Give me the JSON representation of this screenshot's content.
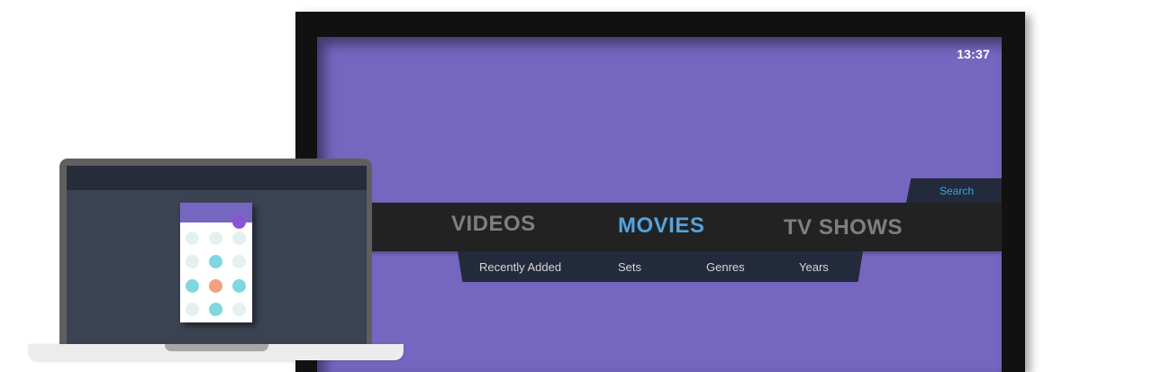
{
  "tv": {
    "clock": "13:37",
    "search_label": "Search",
    "menu": [
      {
        "label": "VIDEOS",
        "state": "inactive"
      },
      {
        "label": "MOVIES",
        "state": "active"
      },
      {
        "label": "TV SHOWS",
        "state": "inactive"
      }
    ],
    "submenu": [
      "Recently Added",
      "Sets",
      "Genres",
      "Years"
    ]
  },
  "colors": {
    "screen_bg": "#7566c0",
    "menu_active": "#54a3de",
    "menu_inactive": "#7f7f7f",
    "search_text": "#2fa6e6",
    "dot_light": "#e3f1ef",
    "dot_cyan": "#7fd7e0",
    "dot_orange": "#f2a081",
    "dot_purple": "#8a53d6"
  },
  "laptop": {
    "remote_app": {
      "grid": [
        [
          "light",
          "light",
          "light"
        ],
        [
          "light",
          "cyan",
          "light"
        ],
        [
          "cyan",
          "orange",
          "cyan"
        ],
        [
          "light",
          "cyan",
          "light"
        ]
      ]
    }
  }
}
